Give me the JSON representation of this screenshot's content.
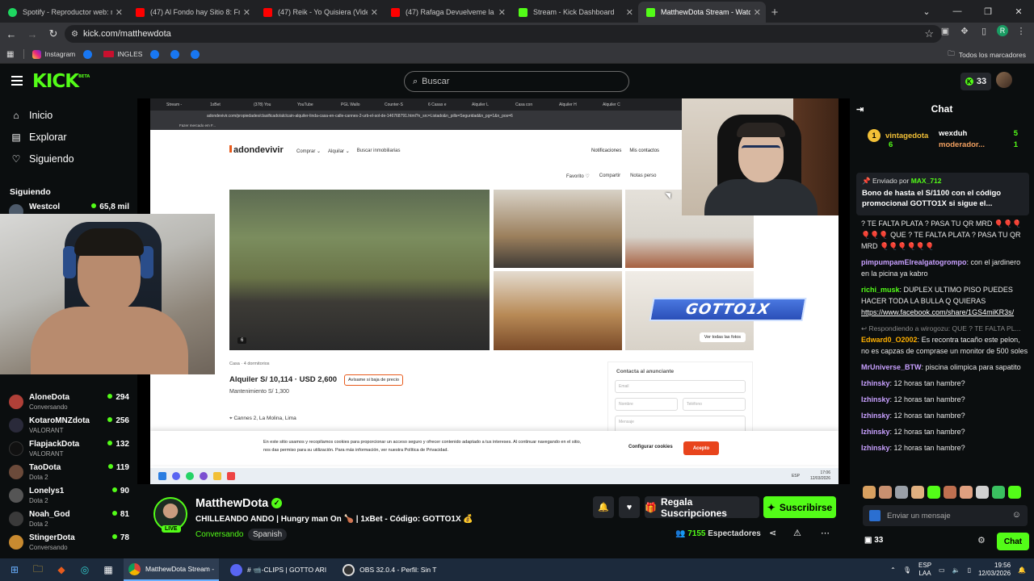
{
  "browser": {
    "tabs": [
      {
        "label": "Spotify - Reproductor web: mú",
        "color": "#1ed760"
      },
      {
        "label": "(47) Al Fondo hay Sitio 8: Franc",
        "color": "#ff0000"
      },
      {
        "label": "(47) Reik - Yo Quisiera (Video)",
        "color": "#ff0000"
      },
      {
        "label": "(47) Rafaga Devuelveme la Vida",
        "color": "#ff0000"
      },
      {
        "label": "Stream - Kick Dashboard",
        "color": "#53fc18"
      },
      {
        "label": "MatthewDota Stream - Watch L",
        "color": "#53fc18"
      }
    ],
    "url": "kick.com/matthewdota",
    "profile_initial": "R",
    "bookmarks": [
      "Instagram",
      "INGLES"
    ],
    "bookmarks_right": "Todos los marcadores"
  },
  "header": {
    "logo": "KICK",
    "logo_sup": "BETA",
    "search_placeholder": "Buscar",
    "kicks_count": "33"
  },
  "sidebar": {
    "nav": [
      {
        "label": "Inicio",
        "icon": "home-icon"
      },
      {
        "label": "Explorar",
        "icon": "browse-icon"
      },
      {
        "label": "Siguiendo",
        "icon": "heart-icon"
      }
    ],
    "following_heading": "Siguiendo",
    "channels": [
      {
        "name": "Westcol",
        "game": "",
        "viewers": "65,8 mil",
        "color": "#4d5a6a"
      },
      {
        "name": "AloneDota",
        "game": "Conversando",
        "viewers": "294",
        "color": "#b04038"
      },
      {
        "name": "KotaroMNZdota",
        "game": "VALORANT",
        "viewers": "256",
        "color": "#2a2a3a"
      },
      {
        "name": "FlapjackDota",
        "game": "VALORANT",
        "viewers": "132",
        "color": "#111"
      },
      {
        "name": "TaoDota",
        "game": "Dota 2",
        "viewers": "119",
        "color": "#6b4a3a"
      },
      {
        "name": "Lonelys1",
        "game": "Dota 2",
        "viewers": "90",
        "color": "#555"
      },
      {
        "name": "Noah_God",
        "game": "Dota 2",
        "viewers": "81",
        "color": "#3a3a3a"
      },
      {
        "name": "StingerDota",
        "game": "Conversando",
        "viewers": "78",
        "color": "#c88a30"
      }
    ]
  },
  "stream": {
    "inner_tabs": [
      "Stream -",
      "1xBet",
      "(378) You",
      "YouTube",
      "PGL Wallo",
      "Counter-S",
      "6 Casas e",
      "Alquiler L",
      "Casa con",
      "Alquiler H",
      "Alquiler C"
    ],
    "inner_url": "adondevivir.com/propiedades/clasificado/alclcain-alquiler-linda-casa-en-calle-cannes-2-urb-el-sol-de-146768791.html?n_src=Listado&n_pills=Seguridad&n_pg=1&n_pos=6",
    "inner_bookmark": "Fazer mercado em F...",
    "site": {
      "logo": "adondevivir",
      "menu": [
        "Comprar ⌄",
        "Alquilar ⌄",
        "Buscar inmobiliarias"
      ],
      "right_menu": [
        "Notificaciones",
        "Mis contactos"
      ],
      "actions": [
        "Favorito ♡",
        "Compartir",
        "Notas perso"
      ],
      "photo_count": "6",
      "see_all": "Ver todas las fotos",
      "overlay_text": "GOTTO1X",
      "type": "Casa · 4 dormitorios",
      "price": "Alquiler S/ 10,114 · USD 2,600",
      "alert_button": "Avísame si baja de precio",
      "maintenance": "Mantenimiento S/ 1,300",
      "location": "Cannes 2, La Molina, Lima",
      "contact_title": "Contacta al anunciante",
      "contact_fields": [
        "Email",
        "Nombre",
        "Teléfono",
        "Mensaje"
      ],
      "cookie_text": "En este sitio usamos y recopilamos cookies para proporcionar un acceso seguro y ofrecer contenido adaptado a tus intereses. Al continuar navegando en el sitio, nos das permiso para su utilización. Para más información, ver nuestra Política de Privacidad.",
      "cookie_config": "Configurar cookies",
      "cookie_accept": "Acepto",
      "inner_time": "17:06",
      "inner_date": "12/03/2026",
      "inner_lang": "ESP"
    }
  },
  "streamer": {
    "name": "MatthewDota",
    "live": "LIVE",
    "title": "CHILLEANDO ANDO | Hungry man On 🍗 | 1xBet - Código: GOTTO1X 💰",
    "category": "Conversando",
    "language": "Spanish",
    "gift_label": "Regala Suscripciones",
    "subscribe_label": "Suscribirse",
    "viewers": "7155",
    "viewers_label": "Espectadores"
  },
  "chat": {
    "title": "Chat",
    "top_gifters": [
      {
        "name": "vintagedota",
        "count": "6",
        "rank": "1"
      },
      {
        "name": "wexduh",
        "count": "5"
      },
      {
        "name": "moderador...",
        "count": "1"
      }
    ],
    "pinned": {
      "by_label": "Enviado por",
      "by_user": "MAX_712",
      "message": "Bono de hasta el S/1100 con el código promocional GOTTO1X si sigue el..."
    },
    "messages": [
      {
        "user": "",
        "color": "#fff",
        "text": "? TE FALTA PLATA ? PASA TU QR MRD 🎈🎈🎈🎈🎈🎈 QUE ? TE FALTA PLATA ? PASA TU QR MRD 🎈🎈🎈🎈🎈🎈"
      },
      {
        "user": "pimpumpamElrealgatogrompo",
        "color": "#c8a0ff",
        "text": "con el jardinero en la picina ya kabro"
      },
      {
        "user": "richi_musk",
        "color": "#53fc18",
        "text": "DUPLEX ULTIMO PISO PUEDES HACER TODA LA BULLA Q QUIERAS"
      },
      {
        "user": "",
        "color": "#fff",
        "text": "",
        "link": "https://www.facebook.com/share/1GS4miKR3s/"
      },
      {
        "user": "",
        "color": "#888",
        "reply": "Respondiendo a wirogozu: QUE ? TE FALTA PL..."
      },
      {
        "user": "Edward0_O2002",
        "color": "#ffb000",
        "text": "Es recontra tacaño este pelon, no es capzas de comprase un monitor de 500 soles"
      },
      {
        "user": "MrUniverse_BTW",
        "color": "#c8a0ff",
        "text": "piscina olimpica para sapatito"
      },
      {
        "user": "Izhinsky",
        "color": "#c8a0ff",
        "text": "12 horas tan hambre?"
      },
      {
        "user": "Izhinsky",
        "color": "#c8a0ff",
        "text": "12 horas tan hambre?"
      },
      {
        "user": "Izhinsky",
        "color": "#c8a0ff",
        "text": "12 horas tan hambre?"
      },
      {
        "user": "Izhinsky",
        "color": "#c8a0ff",
        "text": "12 horas tan hambre?"
      },
      {
        "user": "Izhinsky",
        "color": "#c8a0ff",
        "text": "12 horas tan hambre?"
      }
    ],
    "input_placeholder": "Enviar un mensaje",
    "points": "33",
    "send_label": "Chat"
  },
  "taskbar": {
    "apps": [
      {
        "label": "MatthewDota Stream - ",
        "color": "#f2c037",
        "active": true
      },
      {
        "label": "# 📹-CLIPS | GOTTO ARI",
        "color": "#5865f2",
        "active": false
      },
      {
        "label": "OBS 32.0.4 - Perfil: Sin T",
        "color": "#333",
        "active": false
      }
    ],
    "lang_top": "ESP",
    "lang_bottom": "LAA",
    "time": "19:56",
    "date": "12/03/2026"
  }
}
